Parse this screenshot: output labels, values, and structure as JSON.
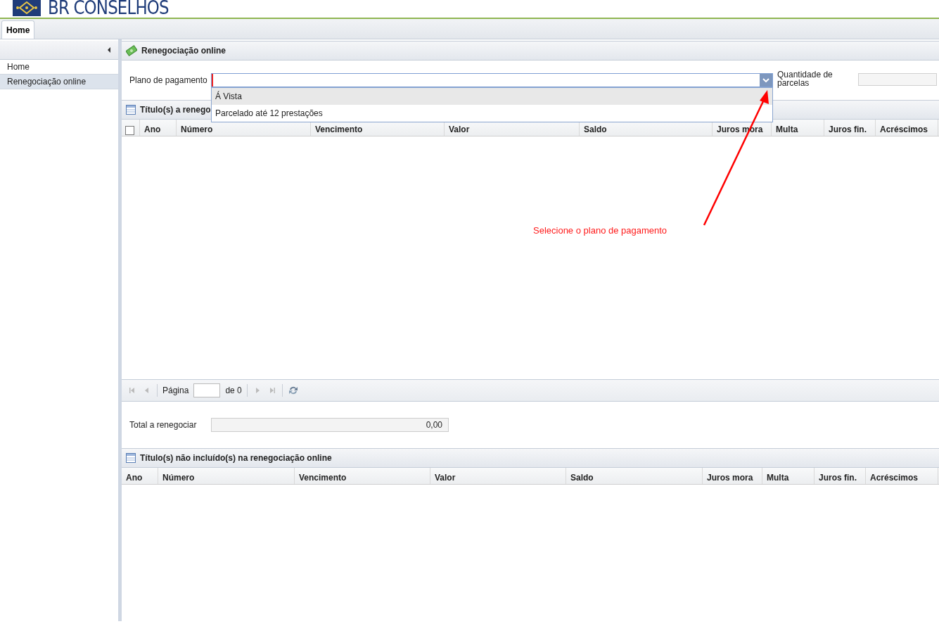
{
  "logo": {
    "text": "BR CONSELHOS"
  },
  "tabs": [
    {
      "label": "Home",
      "selected": true
    }
  ],
  "sidebar": {
    "items": [
      {
        "label": "Home",
        "selected": false
      },
      {
        "label": "Renegociação online",
        "selected": true
      }
    ]
  },
  "panel": {
    "title": "Renegociação online"
  },
  "form": {
    "plan_label": "Plano de pagamento",
    "installments_label": "Quantidade de parcelas"
  },
  "dropdown": {
    "options": [
      {
        "label": "Á Vista",
        "selected": true
      },
      {
        "label": "Parcelado até 12 prestações",
        "selected": false
      }
    ]
  },
  "grid1": {
    "title": "Título(s) a renego",
    "select_all": {
      "checked": false
    },
    "columns": [
      "Ano",
      "Número",
      "Vencimento",
      "Valor",
      "Saldo",
      "Juros mora",
      "Multa",
      "Juros fin.",
      "Acréscimos"
    ]
  },
  "paging": {
    "page_label": "Página",
    "of_label": "de 0"
  },
  "total": {
    "label": "Total a renegociar",
    "value": "0,00"
  },
  "grid2": {
    "title": "Título(s) não incluído(s) na renegociação online",
    "columns": [
      "Ano",
      "Número",
      "Vencimento",
      "Valor",
      "Saldo",
      "Juros mora",
      "Multa",
      "Juros fin.",
      "Acréscimos"
    ]
  },
  "annotation": {
    "text": "Selecione o plano de pagamento"
  }
}
